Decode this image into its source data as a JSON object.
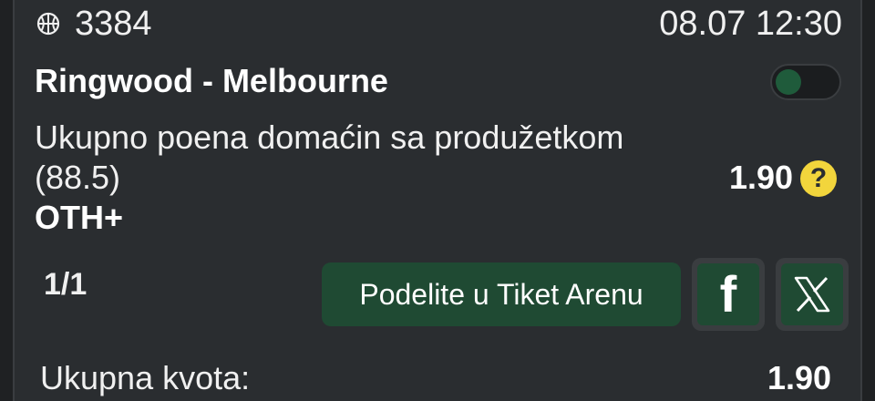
{
  "event": {
    "sport_icon": "basketball-icon",
    "id": "3384",
    "datetime": "08.07 12:30"
  },
  "match": {
    "title": "Ringwood - Melbourne",
    "toggle_on": false
  },
  "market": {
    "line1": "Ukupno poena domaćin sa produžetkom",
    "line2": "(88.5)",
    "selection": "OTH+",
    "odd": "1.90",
    "help_icon": "question-icon",
    "help_glyph": "?"
  },
  "footer": {
    "ticket_count": "1/1",
    "share_label": "Podelite u Tiket Arenu",
    "facebook_icon": "facebook-icon",
    "facebook_glyph": "f",
    "x_icon": "x-icon",
    "total_label": "Ukupna kvota:",
    "total_value": "1.90"
  },
  "colors": {
    "background": "#2a2d30",
    "accent_green": "#1f4a33",
    "help_yellow": "#f2d53c"
  }
}
